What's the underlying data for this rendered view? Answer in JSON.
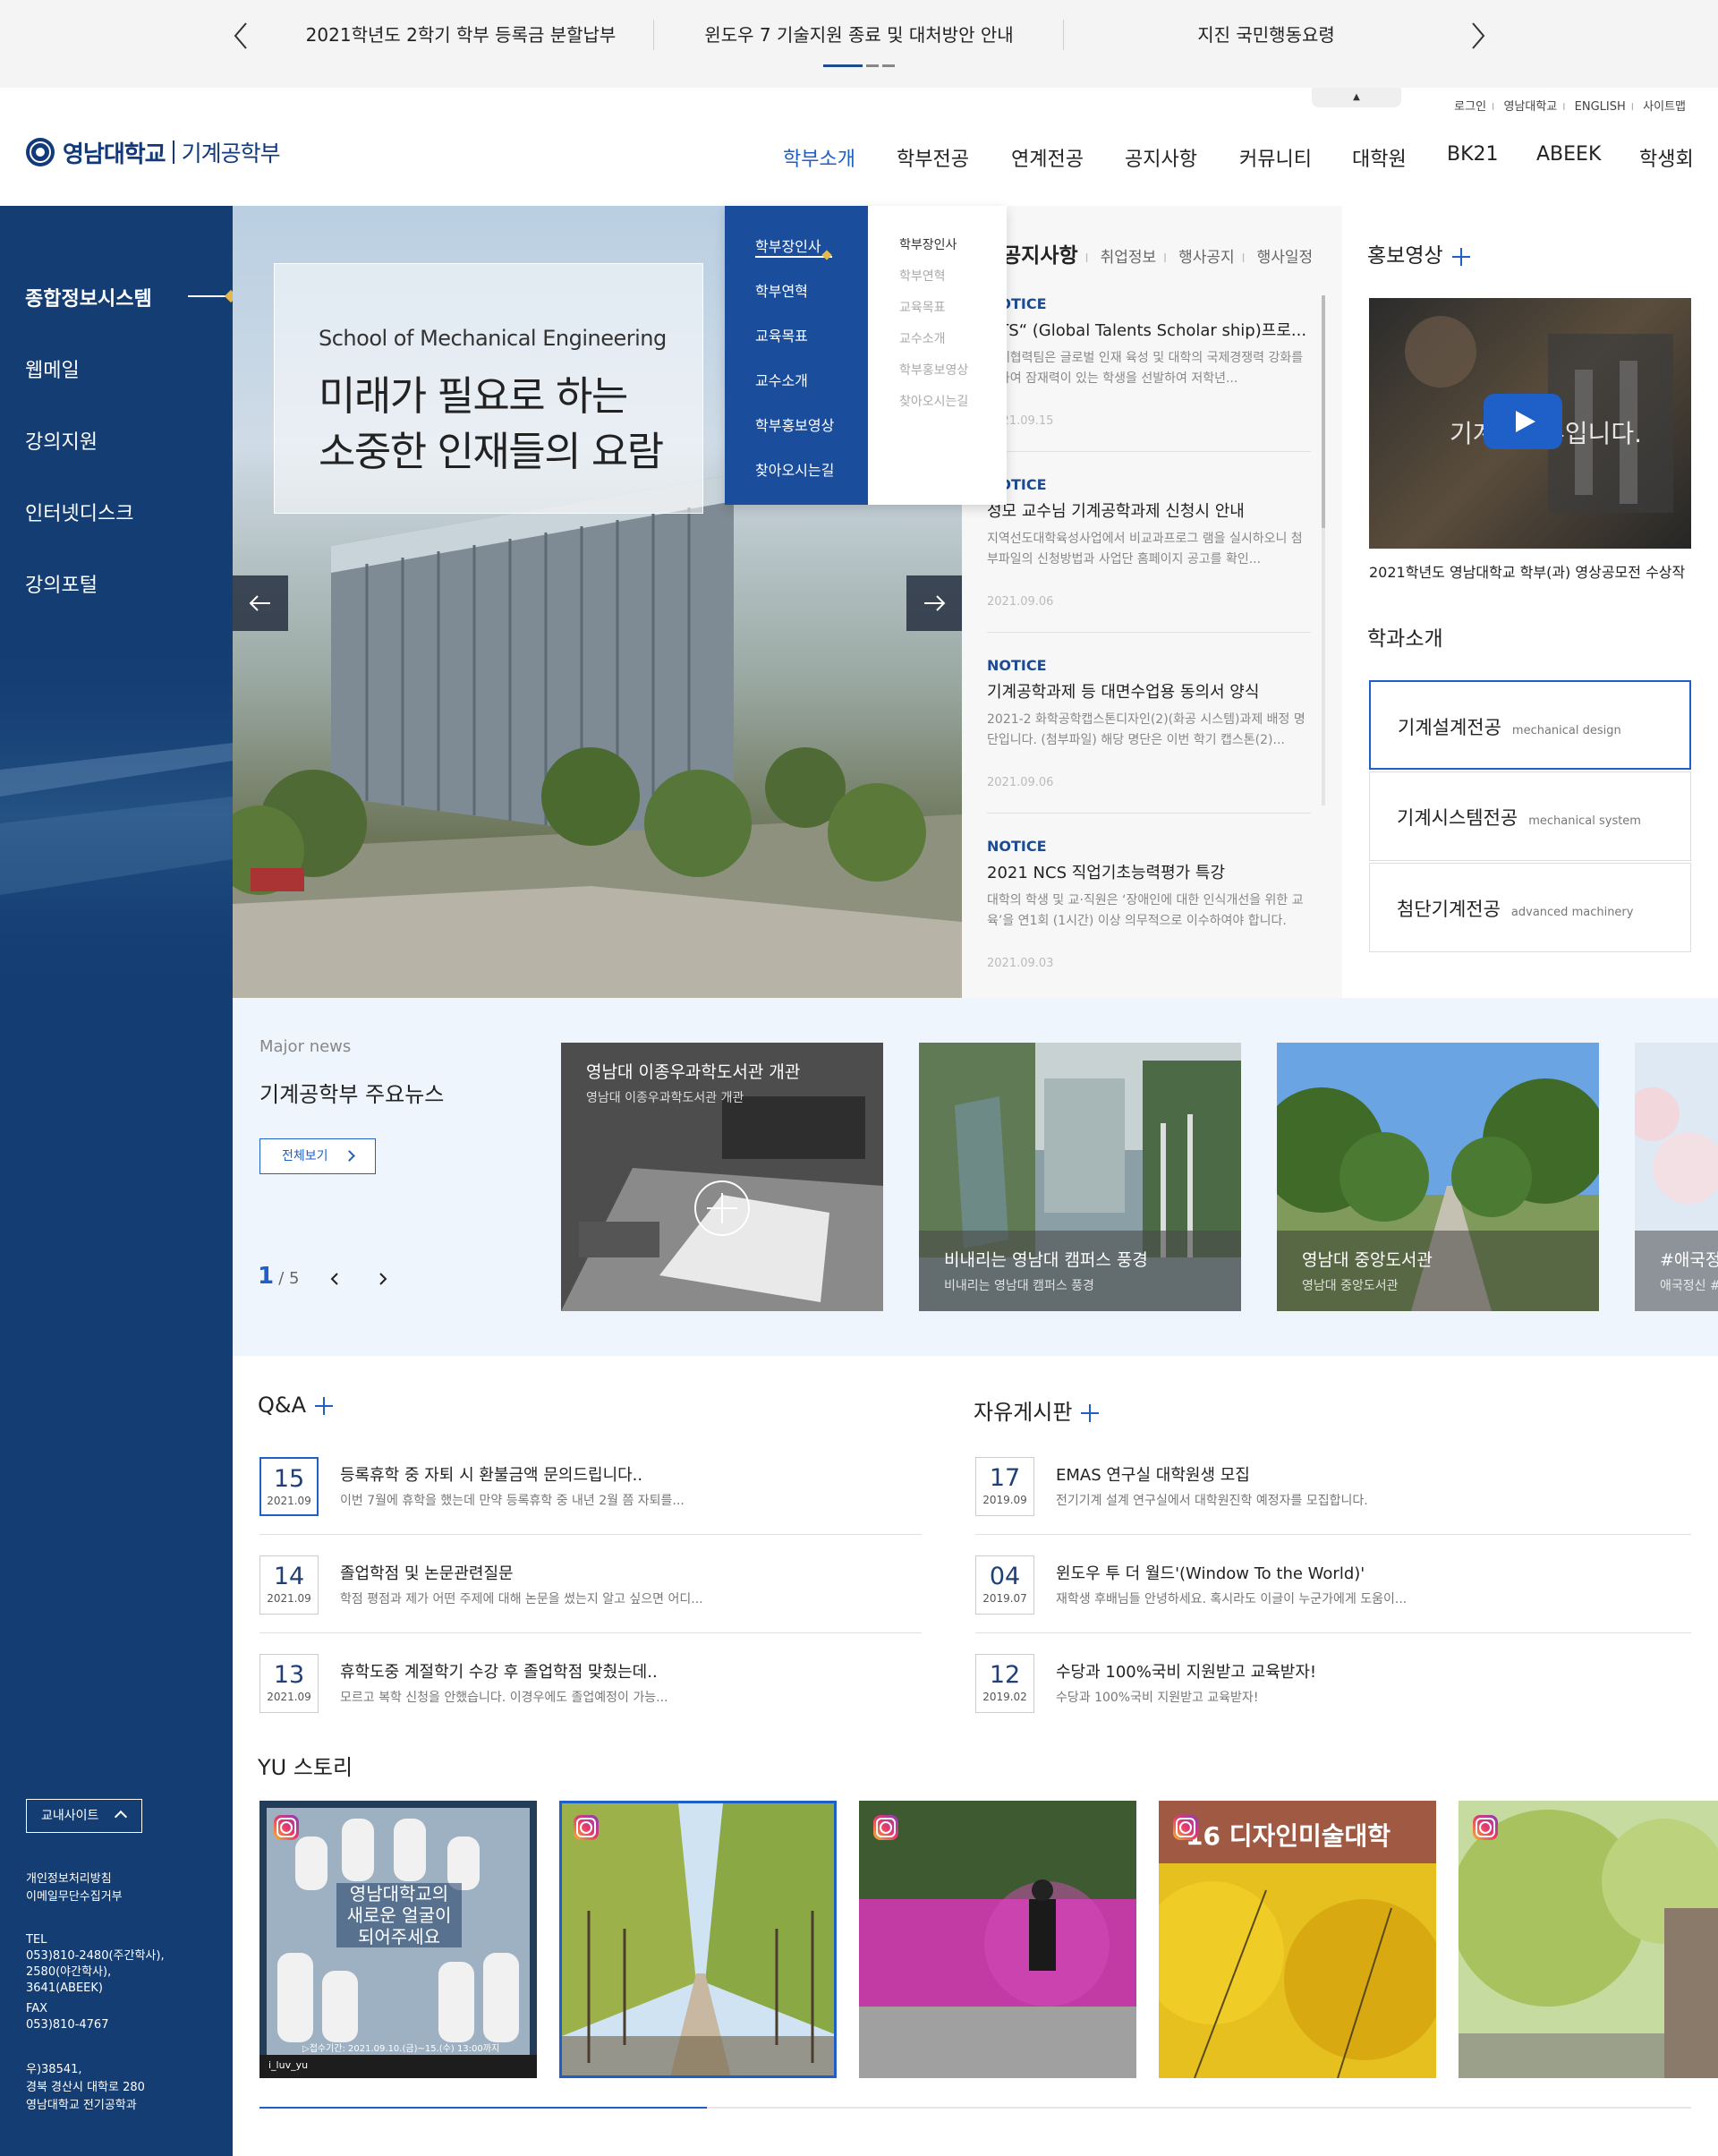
{
  "top_notices": {
    "items": [
      "2021학년도 2학기 학부 등록금 분할납부",
      "윈도우 7 기술지원 종료 및 대처방안 안내",
      "지진 국민행동요령"
    ]
  },
  "header": {
    "logo_name": "영남대학교",
    "logo_dept": "기계공학부",
    "util_links": [
      "로그인",
      "영남대학교",
      "ENGLISH",
      "사이트맵"
    ],
    "gnb": [
      "학부소개",
      "학부전공",
      "연계전공",
      "공지사항",
      "커뮤니티",
      "대학원",
      "BK21",
      "ABEEK",
      "학생회"
    ]
  },
  "dropdown": {
    "primary": [
      "학부장인사",
      "학부연혁",
      "교육목표",
      "교수소개",
      "학부홍보영상",
      "찾아오시는길"
    ],
    "secondary": [
      "학부장인사",
      "학부연혁",
      "교육목표",
      "교수소개",
      "학부홍보영상",
      "찾아오시는길"
    ]
  },
  "sidebar": {
    "items": [
      "종합정보시스템",
      "웹메일",
      "강의지원",
      "인터넷디스크",
      "강의포털"
    ],
    "campus_btn": "교내사이트",
    "policy": [
      "개인정보처리방침",
      "이메일무단수집거부"
    ],
    "tel_label": "TEL",
    "tel_lines": [
      "053)810-2480(주간학사),",
      "2580(야간학사),",
      "3641(ABEEK)"
    ],
    "fax_label": "FAX",
    "fax": "053)810-4767",
    "address": [
      "우)38541,",
      "경북 경산시 대학로 280",
      "영남대학교 전기공학과"
    ]
  },
  "hero": {
    "english": "School of Mechanical Engineering",
    "korean_line1": "미래가 필요로 하는",
    "korean_line2": "소중한 인재들의 요람"
  },
  "notice_board": {
    "tab_main": "공지사항",
    "tabs": [
      "취업정보",
      "행사공지",
      "행사일정"
    ],
    "items": [
      {
        "tag": "NOTICE",
        "title": "GTS“ (Global Talents Scholar ship)프로...",
        "desc": "국제협력팀은 글로벌 인재 육성 및 대학의 국제경쟁력 강화를 위하여 잠재력이 있는 학생을 선발하여 저학년...",
        "date": "2021.09.15"
      },
      {
        "tag": "NOTICE",
        "title": "성모 교수님 기계공학과제 신청시 안내",
        "desc": "지역선도대학육성사업에서 비교과프로그 램을 실시하오니 첨부파일의 신청방법과 사업단 홈페이지 공고를 확인...",
        "date": "2021.09.06"
      },
      {
        "tag": "NOTICE",
        "title": "기계공학과제 등 대면수업용 동의서 양식",
        "desc": "2021-2 화학공학캡스톤디자인(2)(화공 시스템)과제 배정 명단입니다. (첨부파일) 해당 명단은 이번 학기 캡스톤(2)...",
        "date": "2021.09.06"
      },
      {
        "tag": "NOTICE",
        "title": "2021 NCS 직업기초능력평가 특강",
        "desc": "대학의 학생 및 교·직원은 ‘장애인에 대한 인식개선을 위한 교육’을 연1회 (1시간) 이상 의무적으로 이수하여야 합니다.",
        "date": "2021.09.03"
      }
    ]
  },
  "promo": {
    "title": "홍보영상",
    "video_text": "기계공학부입니다.",
    "caption": "2021학년도 영남대학교 학부(과) 영상공모전 수상작"
  },
  "majors": {
    "title": "학과소개",
    "items": [
      {
        "ko": "기계설계전공",
        "en": "mechanical design"
      },
      {
        "ko": "기계시스템전공",
        "en": "mechanical system"
      },
      {
        "ko": "첨단기계전공",
        "en": "advanced machinery"
      }
    ]
  },
  "news": {
    "eyebrow": "Major news",
    "title": "기계공학부 주요뉴스",
    "view_all": "전체보기",
    "page_current": "1",
    "page_total": "/ 5",
    "cards": [
      {
        "title": "영남대 이종우과학도서관 개관",
        "sub": "영남대 이종우과학도서관 개관"
      },
      {
        "title": "비내리는 영남대 캠퍼스 풍경",
        "sub": "비내리는 영남대 캠퍼스 풍경"
      },
      {
        "title": "영남대 중앙도서관",
        "sub": "영남대 중앙도서관"
      },
      {
        "title": "#애국정신",
        "sub": "애국정신 #"
      }
    ]
  },
  "qna": {
    "title": "Q&A",
    "items": [
      {
        "day": "15",
        "ym": "2021.09",
        "title": "등록휴학 중 자퇴 시 환불금액 문의드립니다..",
        "sub": "이번 7월에 휴학을 했는데 만약 등록휴학 중 내년 2월 쯤 자퇴를..."
      },
      {
        "day": "14",
        "ym": "2021.09",
        "title": "졸업학점 및 논문관련질문",
        "sub": "학점 평점과 제가 어떤 주제에 대해 논문을 썼는지 알고 싶으면 어디..."
      },
      {
        "day": "13",
        "ym": "2021.09",
        "title": "휴학도중 계절학기 수강 후 졸업학점 맞췄는데..",
        "sub": "모르고 복학 신청을 안했습니다. 이경우에도 졸업예정이 가능..."
      }
    ]
  },
  "free_board": {
    "title": "자유게시판",
    "items": [
      {
        "day": "17",
        "ym": "2019.09",
        "title": "EMAS 연구실 대학원생 모집",
        "sub": "전기기계 설계 연구실에서 대학원진학 예정자를 모집합니다."
      },
      {
        "day": "04",
        "ym": "2019.07",
        "title": "윈도우 투 더 월드'(Window To the World)'",
        "sub": "재학생 후배님들 안녕하세요. 혹시라도 이글이 누군가에게 도움이..."
      },
      {
        "day": "12",
        "ym": "2019.02",
        "title": "수당과 100%국비 지원받고 교육받자!",
        "sub": "수당과 100%국비 지원받고 교육받자!"
      }
    ]
  },
  "story": {
    "title": "YU 스토리",
    "poster_line1": "영남대학교의",
    "poster_line2": "새로운 얼굴이",
    "poster_line3": "되어주세요",
    "poster_date": "▷접수기간: 2021.09.10.(금)~15.(수) 13:00까지",
    "poster_handle": "i_luv_yu",
    "sign_text": "16 디자인미술대학"
  },
  "colors": {
    "navy": "#133d73",
    "accent": "#1e5fc8",
    "dropdown_blue": "#1a4e9c"
  }
}
